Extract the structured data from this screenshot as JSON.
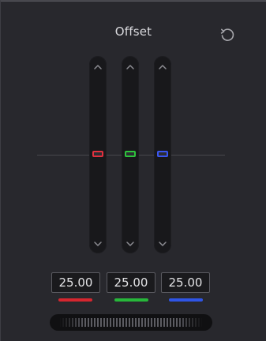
{
  "panel": {
    "title": "Offset"
  },
  "icons": {
    "reset": "reset-icon",
    "up": "chevron-up-icon",
    "down": "chevron-down-icon"
  },
  "channels": [
    {
      "name": "red",
      "value": "25.00",
      "color": "#d6262f",
      "level": 0.5
    },
    {
      "name": "green",
      "value": "25.00",
      "color": "#27b73a",
      "level": 0.5
    },
    {
      "name": "blue",
      "value": "25.00",
      "color": "#2f55e6",
      "level": 0.5
    }
  ]
}
